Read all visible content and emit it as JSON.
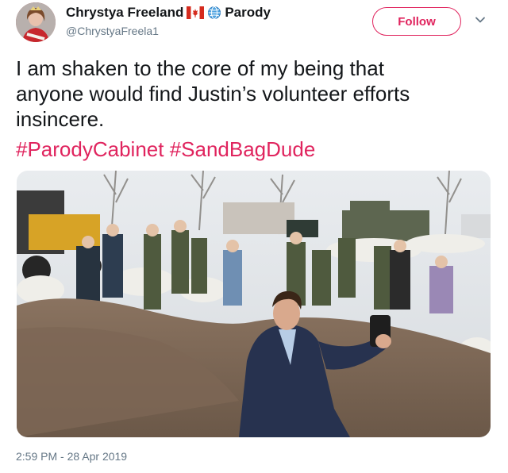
{
  "author": {
    "display_name": "Chrystya Freeland",
    "badge_text": "Parody",
    "handle": "@ChrystyaFreela1",
    "flag_icon": "canada-flag-icon",
    "globe_icon": "globe-icon"
  },
  "actions": {
    "follow_label": "Follow",
    "accent_color": "#e0245e"
  },
  "tweet": {
    "lines": [
      "I am shaken to the core of my being that",
      "anyone would find Justin’s volunteer efforts",
      "insincere."
    ],
    "hashtags": [
      "#ParodyCabinet",
      "#SandBagDude"
    ]
  },
  "meta": {
    "timestamp": "2:59 PM - 28 Apr 2019"
  }
}
